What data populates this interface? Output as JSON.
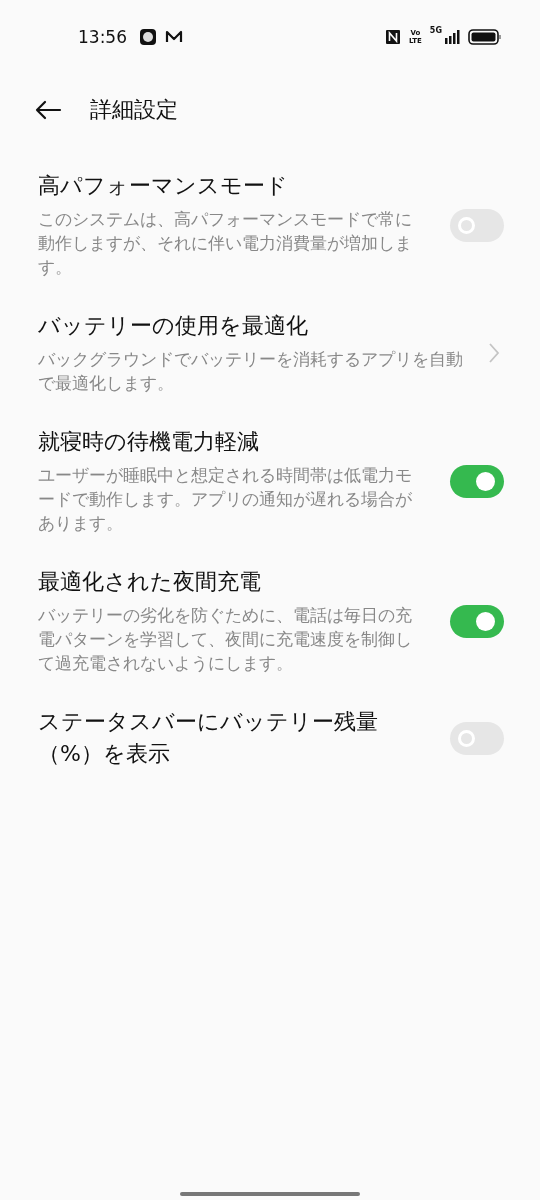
{
  "status_bar": {
    "time": "13:56",
    "volte": [
      "Vo",
      "LTE"
    ],
    "network": "5G"
  },
  "header": {
    "title": "詳細設定"
  },
  "items": [
    {
      "kind": "toggle",
      "title": "高パフォーマンスモード",
      "description": "このシステムは、高パフォーマンスモードで常に動作しますが、それに伴い電力消費量が増加します。",
      "on": false
    },
    {
      "kind": "link",
      "title": "バッテリーの使用を最適化",
      "description": "バックグラウンドでバッテリーを消耗するアプリを自動で最適化します。"
    },
    {
      "kind": "toggle",
      "title": "就寝時の待機電力軽減",
      "description": "ユーザーが睡眠中と想定される時間帯は低電力モードで動作します。アプリの通知が遅れる場合があります。",
      "on": true
    },
    {
      "kind": "toggle",
      "title": "最適化された夜間充電",
      "description": "バッテリーの劣化を防ぐために、電話は毎日の充電パターンを学習して、夜間に充電速度を制御して過充電されないようにします。",
      "on": true
    },
    {
      "kind": "toggle",
      "title": "ステータスバーにバッテリー残量（%）を表示",
      "on": false
    }
  ]
}
